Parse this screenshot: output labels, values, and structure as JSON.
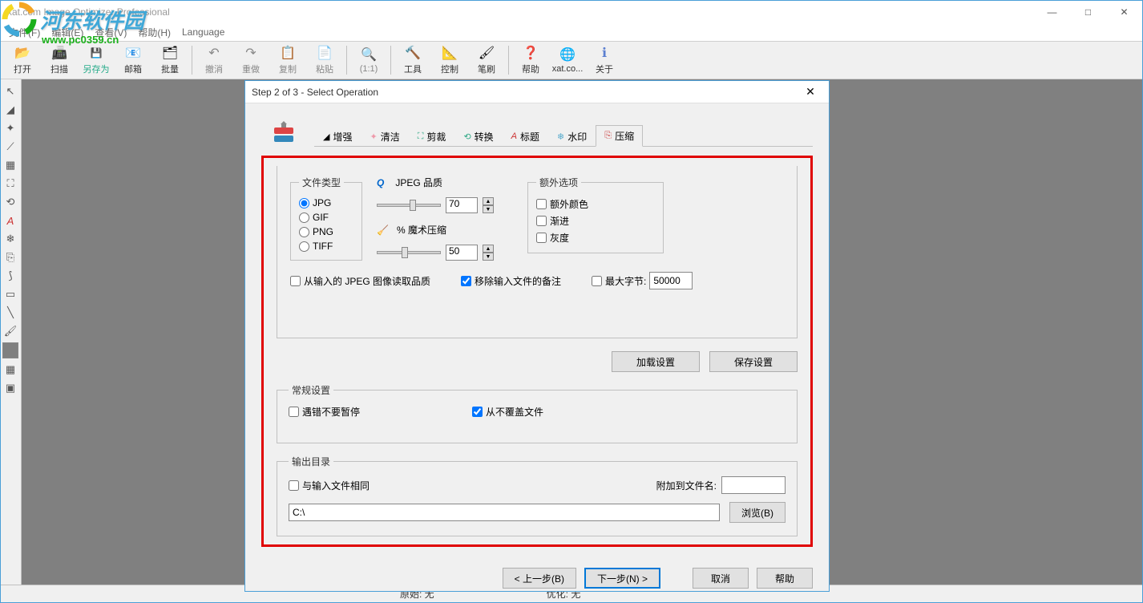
{
  "window": {
    "title": "xat.com  Image Optimizer Professional",
    "controls": {
      "min": "—",
      "max": "□",
      "close": "✕"
    }
  },
  "menubar": [
    "文件(F)",
    "编辑(E)",
    "查看(V)",
    "帮助(H)",
    "Language"
  ],
  "toolbar": [
    {
      "label": "打开",
      "icon": "📂"
    },
    {
      "label": "扫描",
      "icon": "📠"
    },
    {
      "label": "另存为",
      "icon": "💾"
    },
    {
      "label": "邮箱",
      "icon": "📧"
    },
    {
      "label": "批量",
      "icon": "🗂"
    },
    {
      "sep": true
    },
    {
      "label": "撤消",
      "icon": "↶"
    },
    {
      "label": "重做",
      "icon": "↷"
    },
    {
      "label": "复制",
      "icon": "📋"
    },
    {
      "label": "粘贴",
      "icon": "📄"
    },
    {
      "sep": true
    },
    {
      "label": "(1:1)",
      "icon": "🔍"
    },
    {
      "sep": true
    },
    {
      "label": "工具",
      "icon": "🔨"
    },
    {
      "label": "控制",
      "icon": "📐"
    },
    {
      "label": "笔刷",
      "icon": "🖌"
    },
    {
      "sep": true
    },
    {
      "label": "帮助",
      "icon": "❓"
    },
    {
      "label": "xat.co...",
      "icon": "🌐"
    },
    {
      "label": "关于",
      "icon": "ℹ"
    }
  ],
  "watermark": {
    "text": "河东软件园",
    "url": "www.pc0359.cn"
  },
  "status": {
    "orig": "原始: 无",
    "opt": "优化: 无"
  },
  "dialog": {
    "title": "Step 2 of 3 - Select Operation",
    "tabs": [
      {
        "icon": "◢",
        "label": "增强"
      },
      {
        "icon": "✦",
        "label": "清洁"
      },
      {
        "icon": "⛶",
        "label": "剪裁"
      },
      {
        "icon": "⟲",
        "label": "转换"
      },
      {
        "icon": "A",
        "label": "标题"
      },
      {
        "icon": "❄",
        "label": "水印"
      },
      {
        "icon": "⎘",
        "label": "压缩",
        "active": true
      }
    ],
    "filetype": {
      "legend": "文件类型",
      "options": [
        "JPG",
        "GIF",
        "PNG",
        "TIFF"
      ],
      "selected": "JPG"
    },
    "quality": {
      "jpeg_label": "JPEG 品质",
      "jpeg_value": "70",
      "magic_label": "% 魔术压缩",
      "magic_value": "50"
    },
    "extra": {
      "legend": "额外选项",
      "opts": [
        "额外颜色",
        "渐进",
        "灰度"
      ]
    },
    "checks": {
      "read_jpeg": "从输入的 JPEG 图像读取品质",
      "remove_comment": "移除输入文件的备注",
      "max_bytes_label": "最大字节:",
      "max_bytes_value": "50000"
    },
    "actions": {
      "load": "加载设置",
      "save": "保存设置"
    },
    "general": {
      "legend": "常规设置",
      "no_pause": "遇错不要暂停",
      "no_overwrite": "从不覆盖文件"
    },
    "output": {
      "legend": "输出目录",
      "same_as_input": "与输入文件相同",
      "append_label": "附加到文件名:",
      "append_value": "",
      "path": "C:\\",
      "browse": "浏览(B)"
    },
    "footer": {
      "prev": "< 上一步(B)",
      "next": "下一步(N) >",
      "cancel": "取消",
      "help": "帮助"
    }
  }
}
